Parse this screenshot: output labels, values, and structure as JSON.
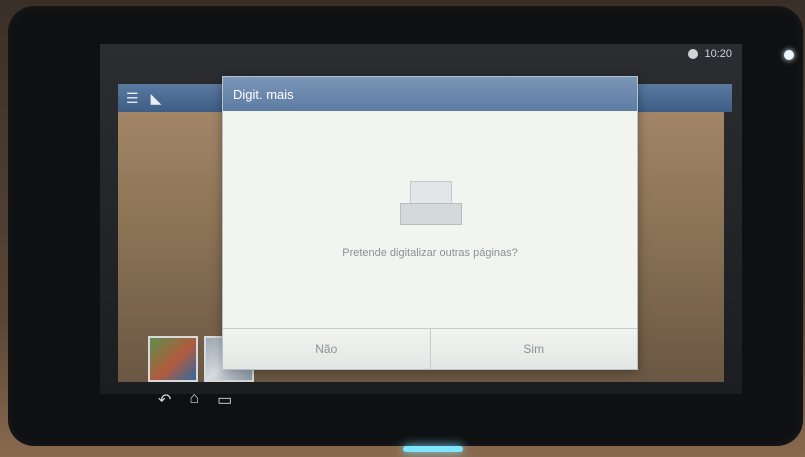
{
  "status": {
    "time": "10:20"
  },
  "dialog": {
    "title": "Digit. mais",
    "prompt": "Pretende digitalizar outras páginas?",
    "buttons": {
      "no": "Não",
      "yes": "Sim"
    }
  },
  "icons": {
    "menu": "menu-icon",
    "app": "app-icon",
    "scan": "scanner-icon",
    "back": "back-icon",
    "home": "home-icon",
    "recent": "recent-apps-icon"
  }
}
